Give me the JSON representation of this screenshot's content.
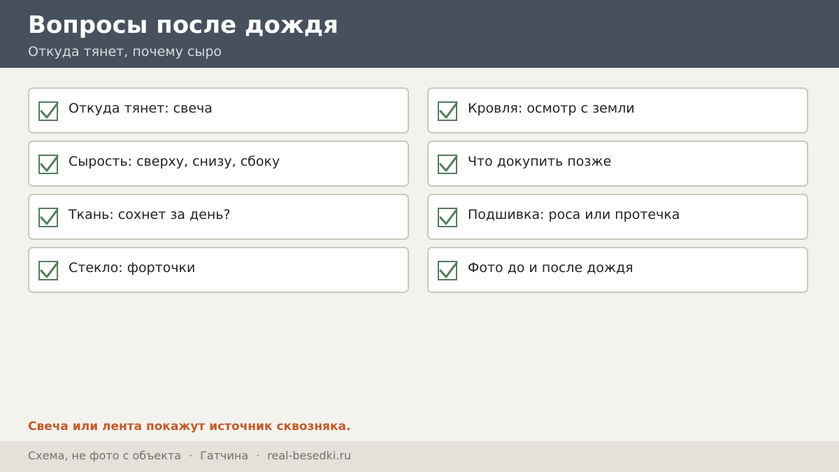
{
  "header": {
    "title": "Вопросы после дождя",
    "subtitle": "Откуда тянет, почему сыро"
  },
  "checklist": {
    "items": [
      {
        "label": "Откуда тянет: свеча",
        "checked": true
      },
      {
        "label": "Кровля: осмотр с земли",
        "checked": true
      },
      {
        "label": "Сырость: сверху, снизу, сбоку",
        "checked": true
      },
      {
        "label": "Что докупить позже",
        "checked": true
      },
      {
        "label": "Ткань: сохнет за день?",
        "checked": true
      },
      {
        "label": "Подшивка: роса или протечка",
        "checked": true
      },
      {
        "label": "Стекло: форточки",
        "checked": true
      },
      {
        "label": "Фото до и после дождя",
        "checked": true
      }
    ]
  },
  "note": "Свеча или лента покажут источник сквозняка.",
  "footer": {
    "part1": "Схема, не фото с объекта",
    "part2": "Гатчина",
    "part3": "real-besedki.ru",
    "separator": "·"
  },
  "colors": {
    "header_bg": "#47515d",
    "check": "#557c5b",
    "accent": "#c05b2a"
  },
  "icons": {
    "check": "checkbox-checked-icon"
  }
}
